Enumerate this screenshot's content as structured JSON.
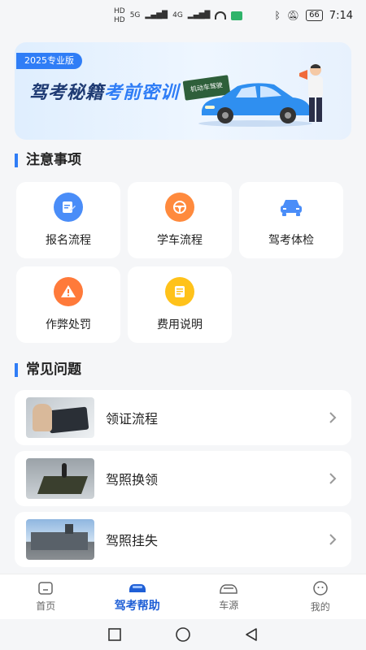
{
  "status_bar": {
    "network_1": "HD",
    "network_2": "HD",
    "signal_1": "5G",
    "signal_2": "4G",
    "battery": "66",
    "time": "7:14"
  },
  "banner": {
    "tag": "2025专业版",
    "title_part1": "驾考秘籍",
    "title_part2": "考前密训",
    "sign_text": "机动车驾驶"
  },
  "notice": {
    "title": "注意事项",
    "items": [
      {
        "label": "报名流程",
        "icon": "edit-doc-icon",
        "color": "#4a8df8"
      },
      {
        "label": "学车流程",
        "icon": "steering-wheel-icon",
        "color": "#ff8a3d"
      },
      {
        "label": "驾考体检",
        "icon": "car-icon",
        "color": "#4a8df8"
      },
      {
        "label": "作弊处罚",
        "icon": "warning-icon",
        "color": "#ff7a3a"
      },
      {
        "label": "费用说明",
        "icon": "receipt-icon",
        "color": "#ffc21a"
      }
    ]
  },
  "faq": {
    "title": "常见问题",
    "items": [
      {
        "label": "领证流程"
      },
      {
        "label": "驾照换领"
      },
      {
        "label": "驾照挂失"
      }
    ]
  },
  "tabs": [
    {
      "label": "首页",
      "icon": "home-icon"
    },
    {
      "label": "驾考帮助",
      "icon": "car-help-icon"
    },
    {
      "label": "车源",
      "icon": "car-outline-icon"
    },
    {
      "label": "我的",
      "icon": "profile-icon"
    }
  ],
  "colors": {
    "accent": "#2f7df6",
    "active_tab": "#1f5fd6",
    "background": "#f5f6f8"
  }
}
